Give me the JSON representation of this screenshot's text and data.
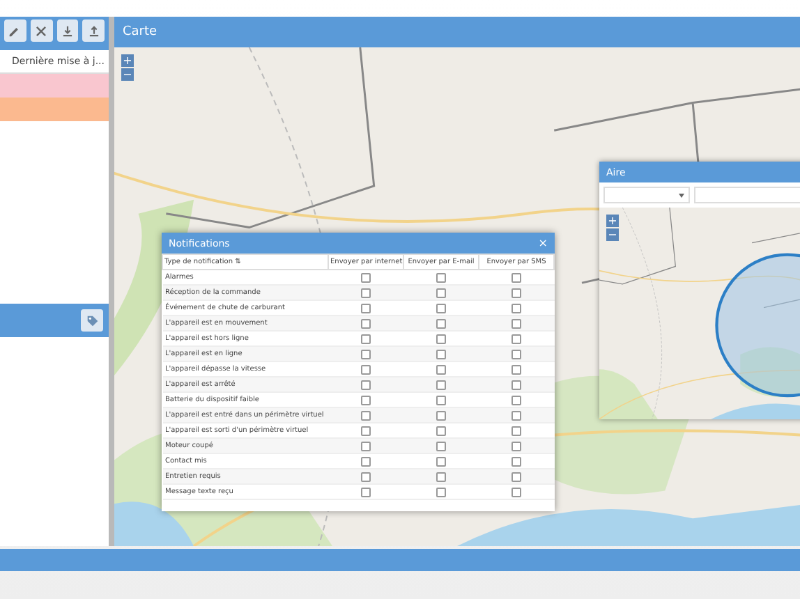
{
  "sidebar": {
    "tools": [
      {
        "kind": "edit"
      },
      {
        "kind": "delete"
      },
      {
        "kind": "download"
      },
      {
        "kind": "upload"
      }
    ],
    "column": "Dernière mise à j...",
    "rows": [
      {
        "color": "#f9c6cf"
      },
      {
        "color": "#fbb98f"
      }
    ]
  },
  "lower_panel": {
    "tool": {
      "kind": "tag"
    }
  },
  "map": {
    "title": "Carte",
    "zoom": [
      "+",
      "−"
    ]
  },
  "notifications": {
    "title": "Notifications",
    "close": "×",
    "columns": [
      "Type de notification ⇅",
      "Envoyer par internet",
      "Envoyer par E-mail",
      "Envoyer par SMS"
    ],
    "rows": [
      {
        "label": "Alarmes",
        "checks": [
          false,
          false,
          false
        ]
      },
      {
        "label": "Réception de la commande",
        "checks": [
          false,
          false,
          false
        ]
      },
      {
        "label": "Événement de chute de carburant",
        "checks": [
          false,
          false,
          false
        ]
      },
      {
        "label": "L'appareil est en mouvement",
        "checks": [
          false,
          false,
          false
        ]
      },
      {
        "label": "L'appareil est hors ligne",
        "checks": [
          false,
          false,
          false
        ]
      },
      {
        "label": "L'appareil est en ligne",
        "checks": [
          false,
          false,
          false
        ]
      },
      {
        "label": "L'appareil dépasse la vitesse",
        "checks": [
          false,
          false,
          false
        ]
      },
      {
        "label": "L'appareil est arrêté",
        "checks": [
          false,
          false,
          false
        ]
      },
      {
        "label": "Batterie du dispositif faible",
        "checks": [
          false,
          false,
          false
        ]
      },
      {
        "label": "L'appareil est entré dans un périmètre virtuel",
        "checks": [
          false,
          false,
          false
        ]
      },
      {
        "label": "L'appareil est sorti d'un périmètre virtuel",
        "checks": [
          false,
          false,
          false
        ]
      },
      {
        "label": "Moteur coupé",
        "checks": [
          false,
          false,
          false
        ]
      },
      {
        "label": "Contact mis",
        "checks": [
          false,
          false,
          false
        ]
      },
      {
        "label": "Entretien requis",
        "checks": [
          false,
          false,
          false
        ]
      },
      {
        "label": "Message texte reçu",
        "checks": [
          false,
          false,
          false
        ]
      }
    ]
  },
  "area": {
    "title": "Aire",
    "zoom": [
      "+",
      "−"
    ]
  }
}
